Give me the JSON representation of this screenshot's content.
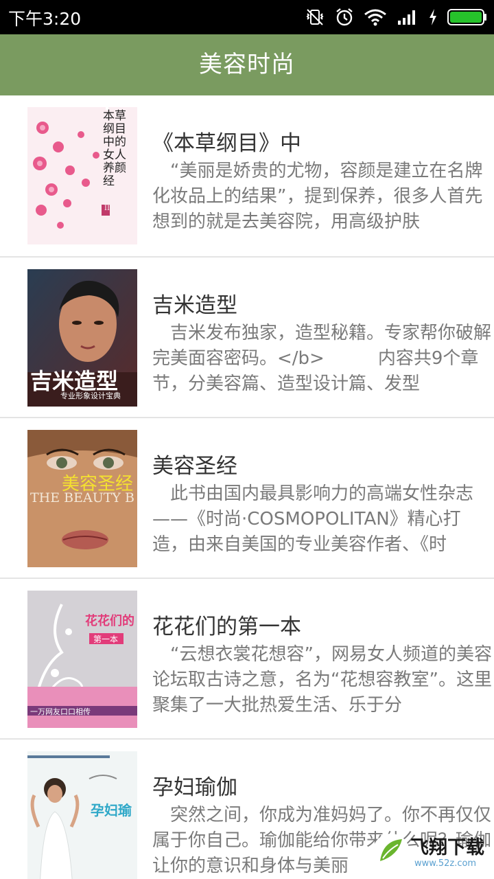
{
  "status_bar": {
    "time": "下午3:20",
    "icons": [
      "vibrate-off-icon",
      "alarm-icon",
      "wifi-icon",
      "signal-icon",
      "charging-icon",
      "battery-icon"
    ]
  },
  "app_bar": {
    "title": "美容时尚",
    "color": "#7a9b60"
  },
  "books": [
    {
      "title": "《本草纲目》中",
      "description": "　“美丽是娇贵的尤物，容颜是建立在名牌化妆品上的结果”，提到保养，很多人首先想到的就是去美容院，用高级护肤",
      "cover_text": "本草纲目中的女人养颜经",
      "cover_badge": "II"
    },
    {
      "title": "吉米造型",
      "description": "　吉米发布独家，造型秘籍。专家帮你破解完美面容密码。</b>　　　内容共9个章节，分美容篇、造型设计篇、发型",
      "cover_text": "吉米造型",
      "cover_subtext": "专业形象设计宝典"
    },
    {
      "title": "美容圣经",
      "description": "　此书由国内最具影响力的高端女性杂志——《时尚·COSMOPOLITAN》精心打造，由来自美国的专业美容作者、《时",
      "cover_text": "美容圣经",
      "cover_subtext": "THE BEAUTY B"
    },
    {
      "title": "花花们的第一本",
      "description": "　“云想衣裳花想容”，网易女人频道的美容论坛取古诗之意，名为“花想容教室”。这里聚集了一大批热爱生活、乐于分",
      "cover_text": "花花们的",
      "cover_subtext": "第一本",
      "cover_bottom": "一万网友口口相传"
    },
    {
      "title": "孕妇瑜伽",
      "description": "　突然之间，你成为准妈妈了。你不再仅仅属于你自己。瑜伽能给你带来什么呢？瑜伽让你的意识和身体与美丽",
      "cover_text": "孕妇瑜"
    }
  ],
  "watermark": {
    "text": "飞翔下载",
    "url_text": "www.52z.com"
  }
}
